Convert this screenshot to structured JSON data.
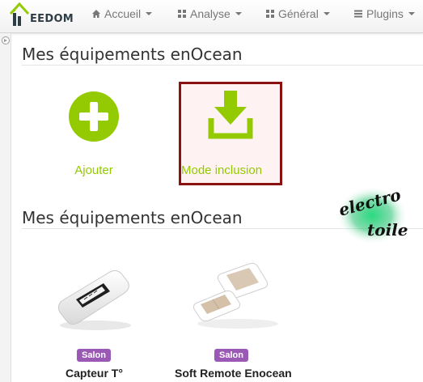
{
  "brand": {
    "logo_text": "EEDOM"
  },
  "navbar": {
    "items": [
      {
        "label": "Accueil",
        "icon": "home-icon"
      },
      {
        "label": "Analyse",
        "icon": "chart-icon"
      },
      {
        "label": "Général",
        "icon": "grid-icon"
      },
      {
        "label": "Plugins",
        "icon": "list-icon"
      }
    ]
  },
  "sections": {
    "actions_title": "Mes équipements enOcean",
    "equipments_title": "Mes équipements enOcean"
  },
  "actions": {
    "add_label": "Ajouter",
    "inclusion_label": "Mode inclusion"
  },
  "watermark": {
    "line1": "electro",
    "line2": "toile"
  },
  "equipments": [
    {
      "room": "Salon",
      "name": "Capteur T°"
    },
    {
      "room": "Salon",
      "name": "Soft Remote Enocean"
    }
  ],
  "colors": {
    "accent": "#94ca02",
    "badge": "#9b59b6",
    "highlight_border": "#8b1010"
  }
}
